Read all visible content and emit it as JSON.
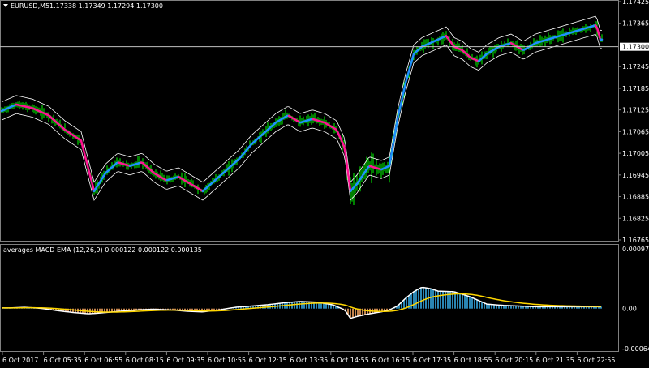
{
  "price_panel": {
    "symbol_header": "EURUSD,M5",
    "ohlc_header": "1.17338 1.17349 1.17294 1.17300",
    "current_price_label": "1.17300",
    "current_price": 1.173,
    "colors": {
      "background": "#000000",
      "bars": "#00ff00",
      "ma_up": "#1e90ff",
      "ma_down": "#ff1493",
      "envelope": "#ffffff",
      "price_line": "#c0c0c0"
    }
  },
  "macd_panel": {
    "header": "averages MACD EMA (12,26,9) 0.000122 0.000122 0.000135",
    "colors": {
      "hist_pos": "#35a7e0",
      "hist_neg": "#f4a460",
      "macd_line": "#ffffff",
      "signal_line": "#ffd700"
    }
  },
  "time_axis": {
    "labels": [
      "6 Oct 2017",
      "6 Oct 05:35",
      "6 Oct 06:55",
      "6 Oct 08:15",
      "6 Oct 09:35",
      "6 Oct 10:55",
      "6 Oct 12:15",
      "6 Oct 13:35",
      "6 Oct 14:55",
      "6 Oct 16:15",
      "6 Oct 17:35",
      "6 Oct 18:55",
      "6 Oct 20:15",
      "6 Oct 21:35",
      "6 Oct 22:55"
    ]
  },
  "chart_data": [
    {
      "type": "line",
      "series": [
        {
          "name": "",
          "x": [
            0,
            20,
            40,
            60,
            80,
            100,
            116,
            130,
            145,
            160,
            175,
            190,
            205,
            220,
            235,
            250,
            265,
            280,
            295,
            310,
            325,
            340,
            355,
            370,
            385,
            400,
            415,
            425,
            432,
            440,
            455,
            470,
            480,
            490,
            500,
            510,
            520,
            530,
            540,
            550,
            560,
            570,
            580,
            590,
            600,
            615,
            630,
            645,
            660,
            675,
            690,
            705,
            720,
            735,
            740
          ],
          "values": [
            1.1712,
            1.1714,
            1.1713,
            1.1711,
            1.1707,
            1.1704,
            1.169,
            1.1695,
            1.1698,
            1.1697,
            1.1698,
            1.1695,
            1.1693,
            1.1694,
            1.1692,
            1.169,
            1.1693,
            1.1696,
            1.1699,
            1.1703,
            1.1706,
            1.1709,
            1.1711,
            1.1709,
            1.171,
            1.1709,
            1.1707,
            1.1702,
            1.169,
            1.1692,
            1.1697,
            1.1696,
            1.1697,
            1.171,
            1.172,
            1.1728,
            1.173,
            1.1731,
            1.1732,
            1.1733,
            1.173,
            1.1729,
            1.1727,
            1.1726,
            1.1728,
            1.173,
            1.1731,
            1.1729,
            1.1731,
            1.1732,
            1.1733,
            1.1734,
            1.1735,
            1.1736,
            1.1732
          ]
        }
      ],
      "y_axis_labels": [
        "1.17425",
        "1.17365",
        "1.17245",
        "1.17185",
        "1.17125",
        "1.17065",
        "1.17005",
        "1.16945",
        "1.16885",
        "1.16825",
        "1.16765"
      ],
      "ylim": [
        1.16765,
        1.17425
      ]
    },
    {
      "type": "bar",
      "series": [
        {
          "name": "",
          "x": [
            10,
            30,
            50,
            70,
            90,
            110,
            130,
            150,
            170,
            190,
            210,
            230,
            250,
            270,
            290,
            310,
            330,
            350,
            370,
            390,
            410,
            425,
            432,
            440,
            455,
            470,
            480,
            490,
            500,
            510,
            520,
            530,
            540,
            560,
            580,
            600,
            620,
            640,
            660,
            680,
            700,
            720,
            740
          ],
          "values": [
            1e-05,
            2e-05,
            5e-06,
            -3e-05,
            -6e-05,
            -8e-05,
            -6e-05,
            -4e-05,
            -2e-05,
            -1e-05,
            -2e-05,
            -4e-05,
            -5e-05,
            -2e-05,
            2e-05,
            4e-05,
            6e-05,
            9e-05,
            0.00011,
            0.0001,
            6e-05,
            -2e-05,
            -0.00015,
            -0.00012,
            -8e-05,
            -5e-05,
            -2e-05,
            4e-05,
            0.00016,
            0.00026,
            0.00033,
            0.00031,
            0.00027,
            0.00026,
            0.00018,
            7e-05,
            5e-05,
            4e-05,
            3e-05,
            3e-05,
            3e-05,
            3e-05,
            3e-05
          ]
        }
      ],
      "y_axis_labels": [
        "0.00097",
        "0.00",
        "-0.00064"
      ],
      "ylim": [
        -0.00064,
        0.00097
      ]
    }
  ]
}
